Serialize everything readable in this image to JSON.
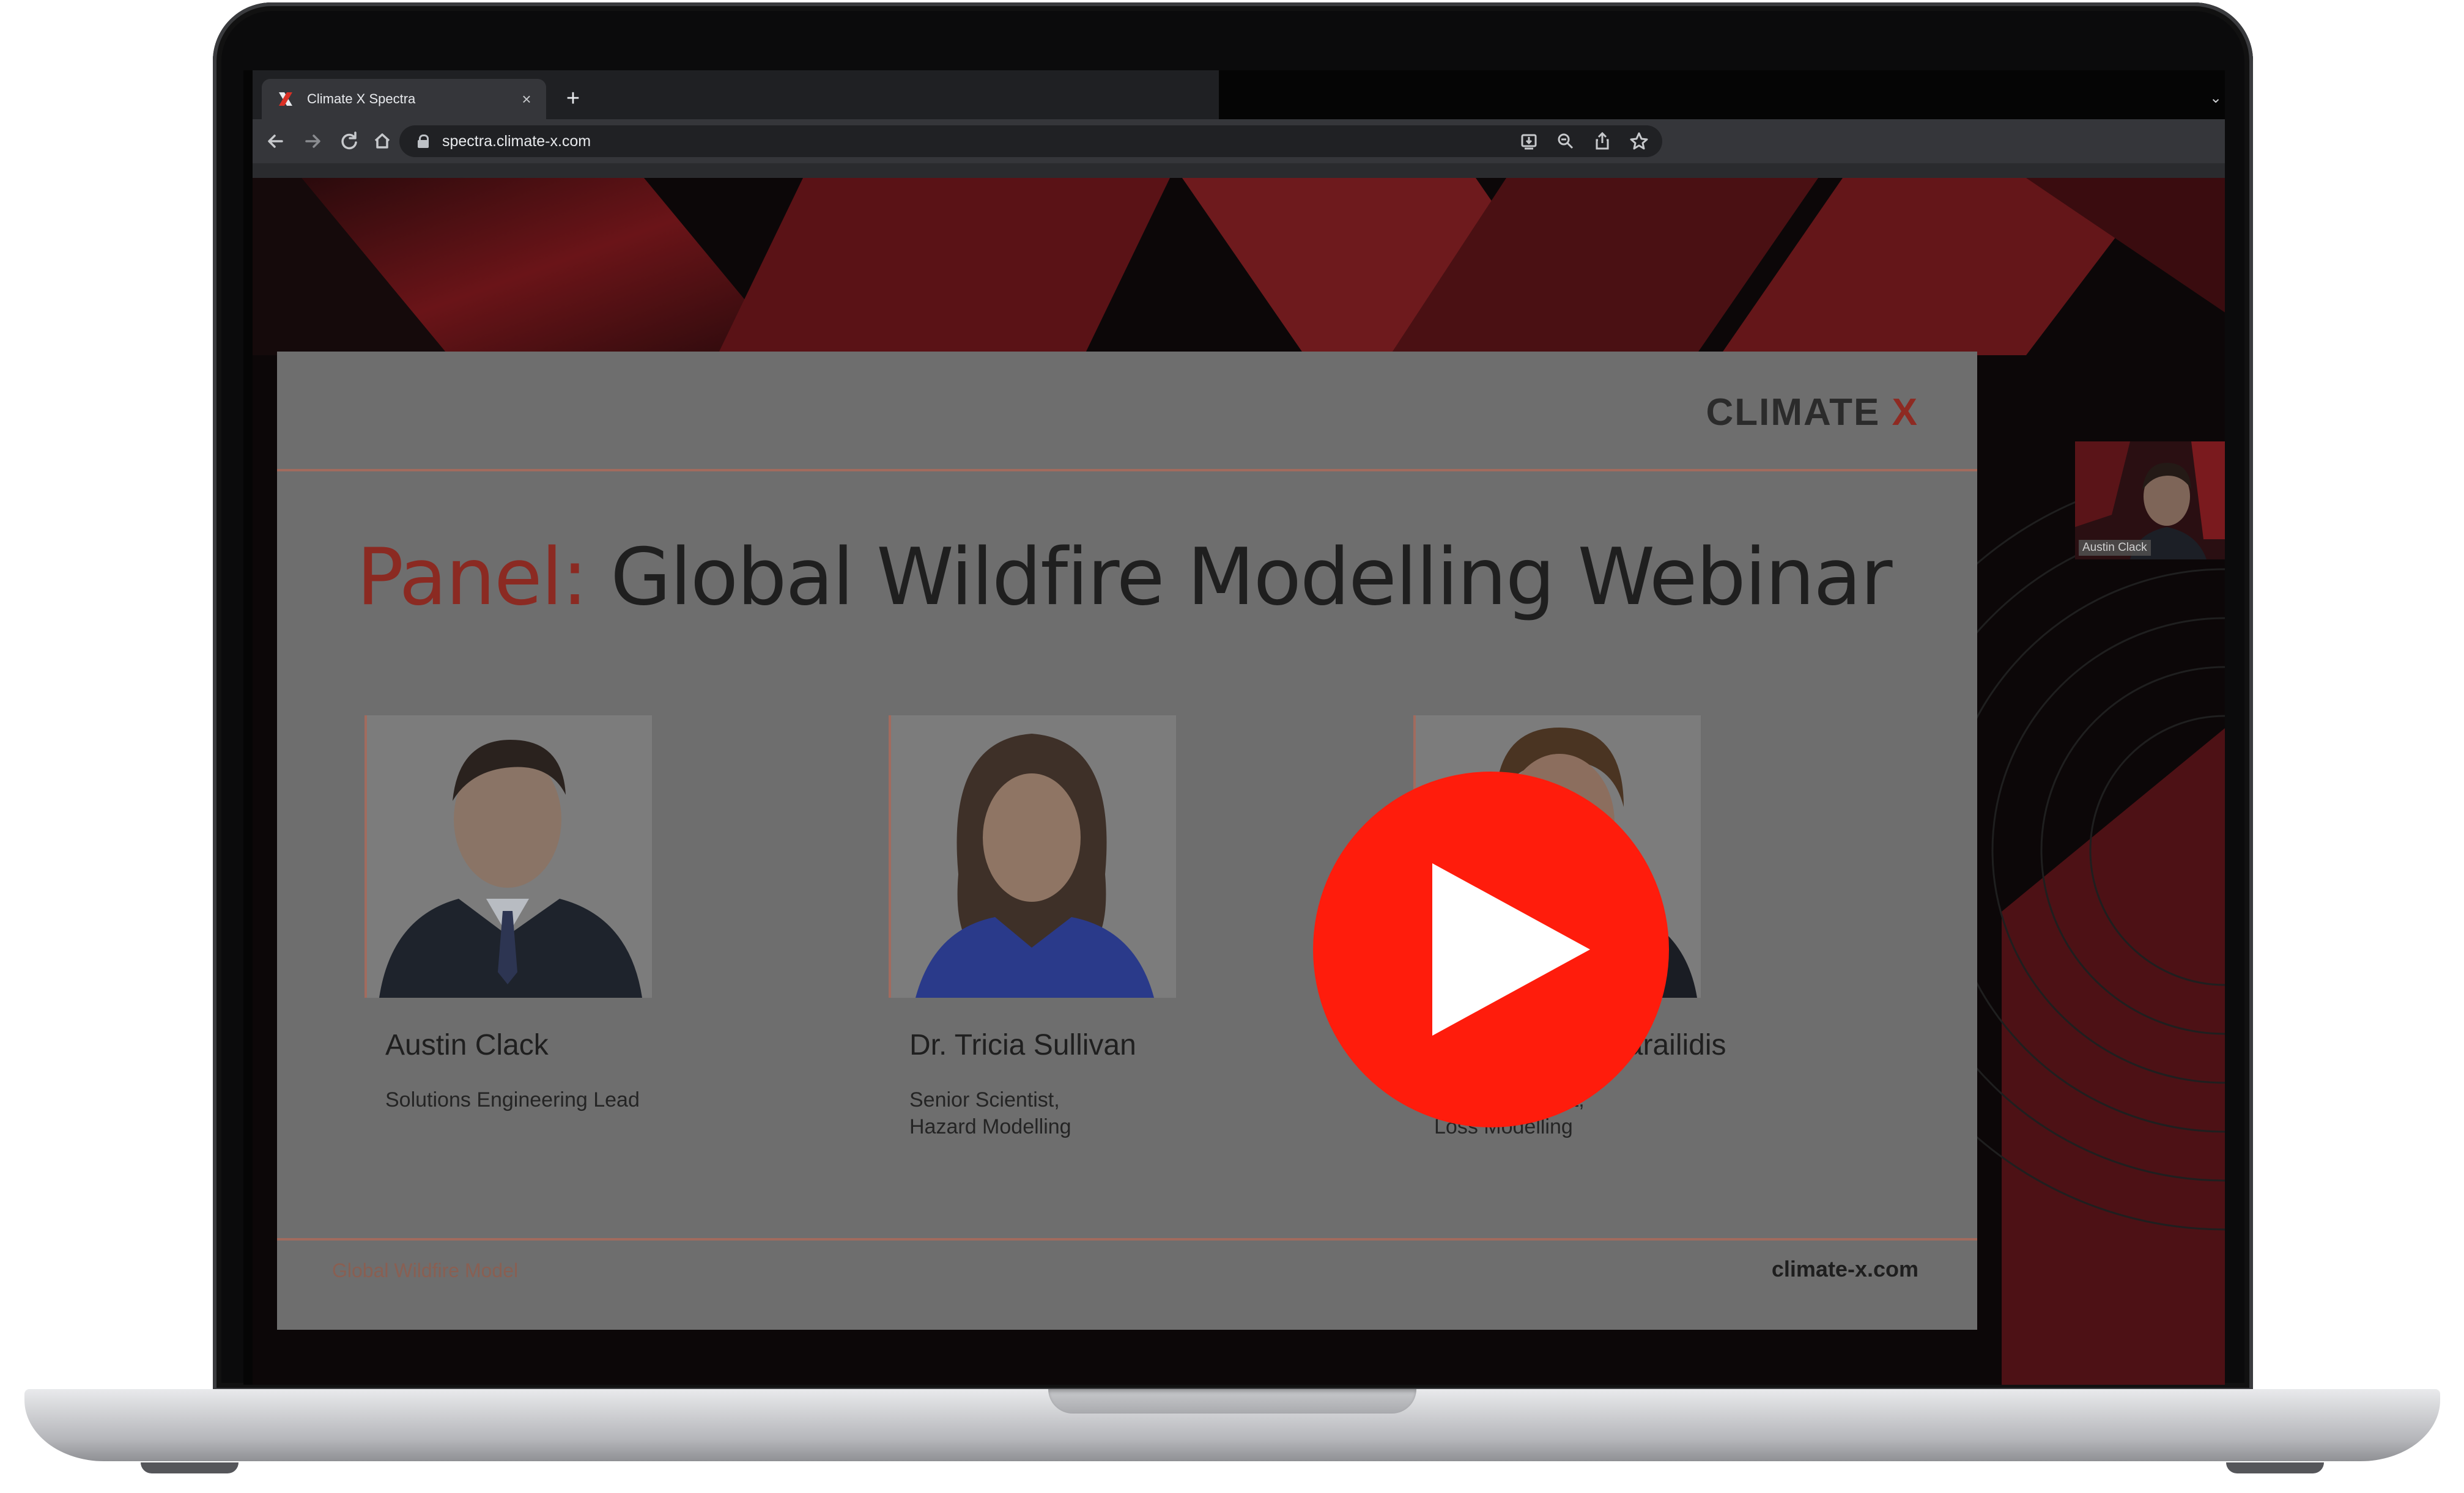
{
  "browser": {
    "tab_title": "Climate X Spectra",
    "url": "spectra.climate-x.com",
    "tab_close": "×",
    "new_tab": "+",
    "tab_menu": "⌄"
  },
  "slide": {
    "logo_text": "CLIMATE",
    "logo_x": "X",
    "title_accent": "Panel:",
    "title_rest": " Global Wildfire Modelling Webinar",
    "panelists": [
      {
        "name": "Austin Clack",
        "role": "Solutions Engineering Lead"
      },
      {
        "name": "Dr. Tricia Sullivan",
        "role": "Senior Scientist,\nHazard Modelling"
      },
      {
        "name": "Dr. Georgios Sarailidis",
        "role": "Senior Scientist,\nLoss Modelling"
      }
    ],
    "footer_left": "Global Wildfire Model",
    "footer_right": "climate-x.com"
  },
  "video_thumbnail": {
    "label": "Austin Clack"
  },
  "colors": {
    "play_button": "#ff1c0c",
    "brand_red": "#8b2a22"
  },
  "icons": {
    "back": "back-arrow-icon",
    "forward": "forward-arrow-icon",
    "reload": "reload-icon",
    "home": "home-icon",
    "install": "install-app-icon",
    "zoom": "zoom-icon",
    "share": "share-icon",
    "bookmark": "star-icon",
    "play": "play-icon"
  }
}
